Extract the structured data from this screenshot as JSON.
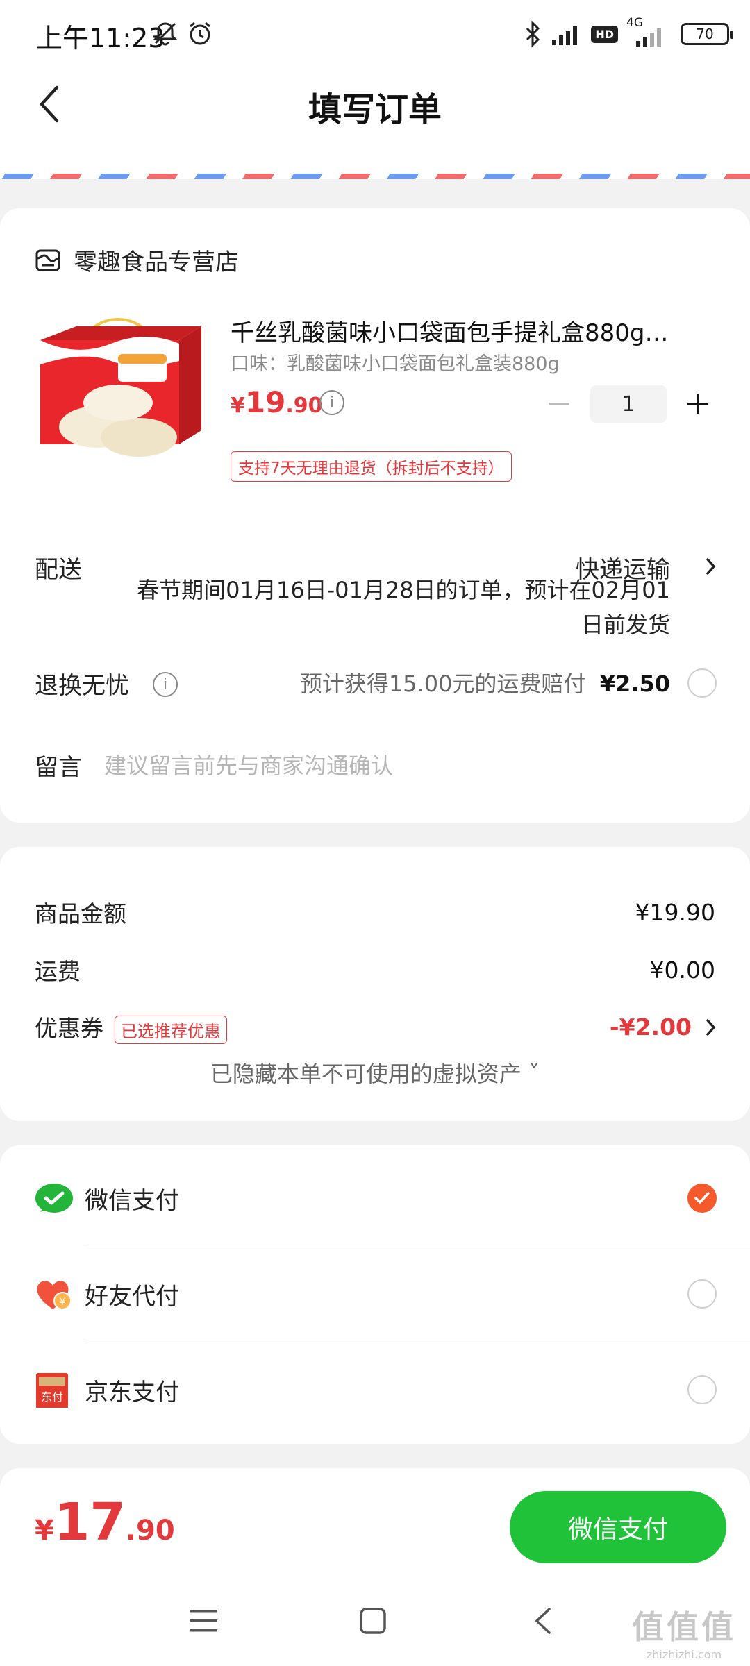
{
  "status_bar": {
    "time": "上午11:23",
    "network": "4G",
    "hd": "HD",
    "battery": "70"
  },
  "header": {
    "title": "填写订单"
  },
  "store": {
    "name": "零趣食品专营店"
  },
  "product": {
    "title": "千丝乳酸菌味小口袋面包手提礼盒880g…",
    "spec": "口味：乳酸菌味小口袋面包礼盒装880g",
    "price_currency": "¥",
    "price_int": "19",
    "price_dec": ".90",
    "quantity": "1",
    "return_policy": "支持7天无理由退货（拆封后不支持）"
  },
  "delivery": {
    "label": "配送",
    "method": "快递运输",
    "note": "春节期间01月16日-01月28日的订单，预计在02月01日前发货"
  },
  "insurance": {
    "label": "退换无忧",
    "text": "预计获得15.00元的运费赔付",
    "price": "¥2.50"
  },
  "message": {
    "label": "留言",
    "placeholder": "建议留言前先与商家沟通确认"
  },
  "summary": {
    "goods_label": "商品金额",
    "goods_value": "¥19.90",
    "shipping_label": "运费",
    "shipping_value": "¥0.00",
    "coupon_label": "优惠券",
    "coupon_tag": "已选推荐优惠",
    "coupon_value": "-¥2.00",
    "hidden_assets": "已隐藏本单不可使用的虚拟资产 ˇ"
  },
  "payment_methods": [
    {
      "label": "微信支付",
      "icon": "wechat-pay-icon",
      "selected": true
    },
    {
      "label": "好友代付",
      "icon": "friend-pay-heart-icon",
      "selected": false
    },
    {
      "label": "京东支付",
      "icon": "jd-pay-icon",
      "selected": false
    }
  ],
  "footer": {
    "total_currency": "¥",
    "total_int": "17",
    "total_dec": ".90",
    "pay_button": "微信支付"
  },
  "watermark": {
    "text": "值值值",
    "url": "zhizhizhi.com"
  },
  "colors": {
    "accent_red": "#e4393c",
    "wechat_green": "#20c23a",
    "radio_selected": "#f55a2c"
  }
}
